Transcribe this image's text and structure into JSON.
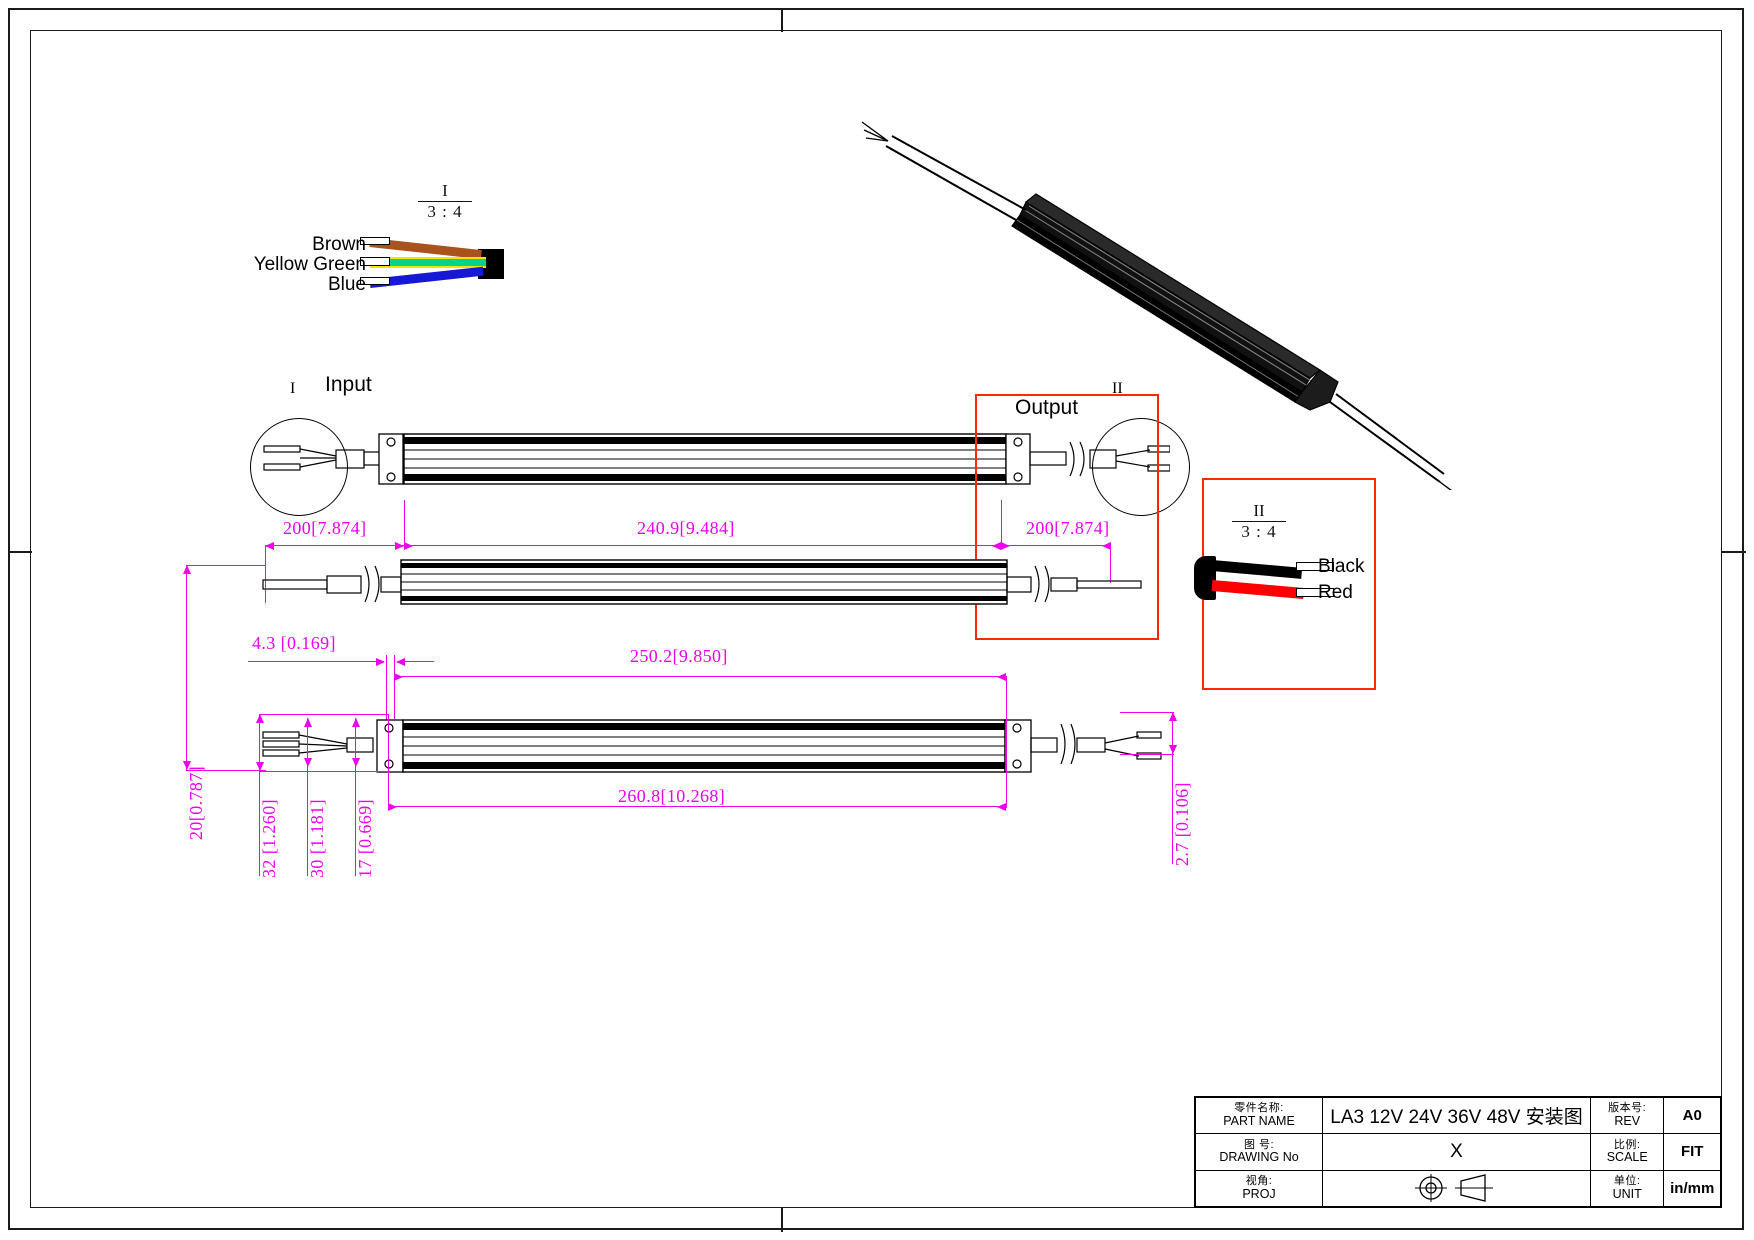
{
  "sheet": {
    "background": "#ffffff",
    "border_color": "#1a1a1a",
    "dimension_color": "#ee00ee",
    "highlight_color": "#ff2800"
  },
  "details": {
    "input_detail": {
      "tag": "I",
      "scale": "3 : 4"
    },
    "output_detail": {
      "tag": "II",
      "scale": "3 : 4"
    }
  },
  "callouts": {
    "input_circle_tag": "I",
    "output_circle_tag": "II",
    "input_label": "Input",
    "output_label": "Output"
  },
  "wires": {
    "input": [
      {
        "label": "Brown",
        "color": "#a9521b"
      },
      {
        "label": "Yellow Green",
        "color": "#00d48a"
      },
      {
        "label": "Blue",
        "color": "#1717d6"
      }
    ],
    "output": [
      {
        "label": "Black",
        "color": "#000000"
      },
      {
        "label": "Red",
        "color": "#ff0000"
      }
    ]
  },
  "dimensions": {
    "input_lead_top": "200[7.874]",
    "body_top": "240.9[9.484]",
    "output_lead_top": "200[7.874]",
    "bracket_offset": "4.3  [0.169]",
    "mount_hole_span": "250.2[9.850]",
    "overall_length": "260.8[10.268]",
    "height_20": "20[0.787]",
    "width_32": "32 [1.260]",
    "width_30": "30 [1.181]",
    "width_17": "17 [0.669]",
    "thickness_2_7": "2.7 [0.106]"
  },
  "title_block": {
    "rows": [
      {
        "label_cn": "零件名称:",
        "label_en": "PART NAME",
        "value": "LA3 12V 24V 36V 48V 安装图",
        "right_label_cn": "版本号:",
        "right_label_en": "REV",
        "right_value": "A0"
      },
      {
        "label_cn": "图 号:",
        "label_en": "DRAWING No",
        "value": "X",
        "right_label_cn": "比例:",
        "right_label_en": "SCALE",
        "right_value": "FIT"
      },
      {
        "label_cn": "视角:",
        "label_en": "PROJ",
        "value": "",
        "right_label_cn": "单位:",
        "right_label_en": "UNIT",
        "right_value": "in/mm"
      }
    ],
    "projection_symbol": "first-angle-projection-symbol"
  }
}
